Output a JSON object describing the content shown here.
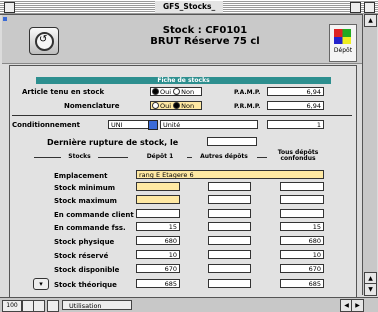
{
  "window": {
    "title": "GFS_Stocks_"
  },
  "header": {
    "line1": "Stock : CF0101",
    "line2": "BRUT Réserve 75 cl",
    "depot_label": "Dépôt"
  },
  "section": {
    "title": "Fiche de stocks"
  },
  "form": {
    "article_label": "Article tenu en stock",
    "article_options": [
      "Oui",
      "Non"
    ],
    "article_selected": "Oui",
    "nomenclature_label": "Nomenclature",
    "nomenclature_options": [
      "Oui",
      "Non"
    ],
    "nomenclature_selected": "Non",
    "pamp_label": "P.A.M.P.",
    "pamp_value": "6,94",
    "prmp_label": "P.R.M.P.",
    "prmp_value": "6,94",
    "cond_label": "Conditionnement",
    "cond_unit": "UNI",
    "cond_desc": "Unité",
    "cond_qty": "1",
    "rupture_label": "Dernière rupture de stock, le",
    "rupture_value": ""
  },
  "columns": {
    "stocks": "Stocks",
    "depot1": "Dépôt 1",
    "autres": "Autres dépôts",
    "tous": "Tous dépôts confondus"
  },
  "rows": [
    {
      "label": "Emplacement",
      "depot1": "rang E Etagere 6",
      "autres": "",
      "tous": ""
    },
    {
      "label": "Stock minimum",
      "depot1": "",
      "autres": "",
      "tous": ""
    },
    {
      "label": "Stock maximum",
      "depot1": "",
      "autres": "",
      "tous": ""
    },
    {
      "label": "En commande client",
      "depot1": "",
      "autres": "",
      "tous": ""
    },
    {
      "label": "En commande fss.",
      "depot1": "15",
      "autres": "",
      "tous": "15"
    },
    {
      "label": "Stock physique",
      "depot1": "680",
      "autres": "",
      "tous": "680"
    },
    {
      "label": "Stock réservé",
      "depot1": "10",
      "autres": "",
      "tous": "10"
    },
    {
      "label": "Stock disponible",
      "depot1": "670",
      "autres": "",
      "tous": "670"
    },
    {
      "label": "Stock théorique",
      "depot1": "685",
      "autres": "",
      "tous": "685"
    }
  ],
  "statusbar": {
    "zoom": "100",
    "mode": "Utilisation"
  }
}
